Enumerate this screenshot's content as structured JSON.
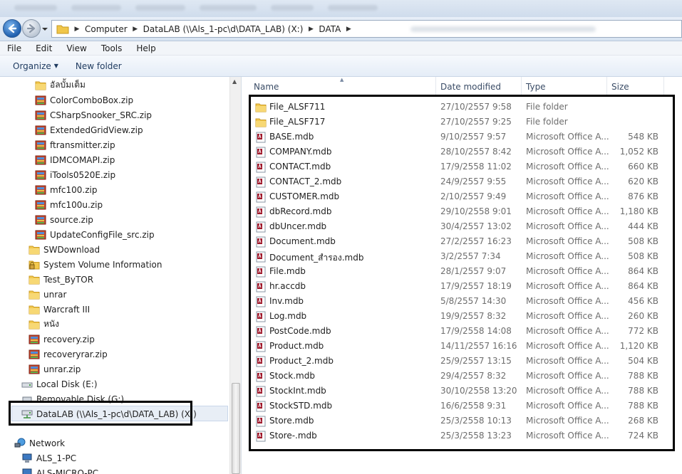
{
  "address": {
    "crumbs": [
      "Computer",
      "DataLAB (\\\\Als_1-pc\\d\\DATA_LAB) (X:)",
      "DATA"
    ]
  },
  "menu": [
    "File",
    "Edit",
    "View",
    "Tools",
    "Help"
  ],
  "toolbar": {
    "organize": "Organize",
    "new_folder": "New folder"
  },
  "nav": {
    "items": [
      {
        "label": "อัลบั้มเต็ม",
        "icon": "folder-icon"
      },
      {
        "label": "ColorComboBox.zip",
        "icon": "zip-archive-icon"
      },
      {
        "label": "CSharpSnooker_SRC.zip",
        "icon": "zip-archive-icon"
      },
      {
        "label": "ExtendedGridView.zip",
        "icon": "zip-archive-icon"
      },
      {
        "label": "ftransmitter.zip",
        "icon": "zip-archive-icon"
      },
      {
        "label": "IDMCOMAPI.zip",
        "icon": "zip-archive-icon"
      },
      {
        "label": "iTools0520E.zip",
        "icon": "zip-archive-icon"
      },
      {
        "label": "mfc100.zip",
        "icon": "zip-archive-icon"
      },
      {
        "label": "mfc100u.zip",
        "icon": "zip-archive-icon"
      },
      {
        "label": "source.zip",
        "icon": "zip-archive-icon"
      },
      {
        "label": "UpdateConfigFile_src.zip",
        "icon": "zip-archive-icon"
      },
      {
        "label": "SWDownload",
        "icon": "folder-icon"
      },
      {
        "label": "System Volume Information",
        "icon": "locked-folder-icon"
      },
      {
        "label": "Test_ByTOR",
        "icon": "folder-icon"
      },
      {
        "label": "unrar",
        "icon": "folder-icon"
      },
      {
        "label": "Warcraft III",
        "icon": "folder-icon"
      },
      {
        "label": "หนัง",
        "icon": "folder-icon"
      },
      {
        "label": "recovery.zip",
        "icon": "zip-archive-icon"
      },
      {
        "label": "recoveryrar.zip",
        "icon": "zip-archive-icon"
      },
      {
        "label": "unrar.zip",
        "icon": "zip-archive-icon"
      },
      {
        "label": "Local Disk (E:)",
        "icon": "drive-icon"
      },
      {
        "label": "Removable Disk (G:)",
        "icon": "removable-drive-icon"
      },
      {
        "label": "DataLAB (\\\\Als_1-pc\\d\\DATA_LAB) (X:)",
        "icon": "network-drive-icon"
      },
      {
        "label": "Network",
        "icon": "network-icon"
      },
      {
        "label": "ALS_1-PC",
        "icon": "computer-icon"
      },
      {
        "label": "ALS-MICRO-PC",
        "icon": "computer-icon"
      }
    ]
  },
  "columns": {
    "name": "Name",
    "date": "Date modified",
    "type": "Type",
    "size": "Size"
  },
  "files": [
    {
      "name": "File_ALSF711",
      "date": "27/10/2557 9:58",
      "type": "File folder",
      "size": "",
      "icon": "folder-icon"
    },
    {
      "name": "File_ALSF717",
      "date": "27/10/2557 9:25",
      "type": "File folder",
      "size": "",
      "icon": "folder-icon"
    },
    {
      "name": "BASE.mdb",
      "date": "9/10/2557 9:57",
      "type": "Microsoft Office A...",
      "size": "548 KB",
      "icon": "access-db-icon"
    },
    {
      "name": "COMPANY.mdb",
      "date": "28/10/2557 8:42",
      "type": "Microsoft Office A...",
      "size": "1,052 KB",
      "icon": "access-db-icon"
    },
    {
      "name": "CONTACT.mdb",
      "date": "17/9/2558 11:02",
      "type": "Microsoft Office A...",
      "size": "660 KB",
      "icon": "access-db-icon"
    },
    {
      "name": "CONTACT_2.mdb",
      "date": "24/9/2557 9:55",
      "type": "Microsoft Office A...",
      "size": "620 KB",
      "icon": "access-db-icon"
    },
    {
      "name": "CUSTOMER.mdb",
      "date": "2/10/2557 9:49",
      "type": "Microsoft Office A...",
      "size": "876 KB",
      "icon": "access-db-icon"
    },
    {
      "name": "dbRecord.mdb",
      "date": "29/10/2558 9:01",
      "type": "Microsoft Office A...",
      "size": "1,180 KB",
      "icon": "access-db-icon"
    },
    {
      "name": "dbUncer.mdb",
      "date": "30/4/2557 13:02",
      "type": "Microsoft Office A...",
      "size": "444 KB",
      "icon": "access-db-icon"
    },
    {
      "name": "Document.mdb",
      "date": "27/2/2557 16:23",
      "type": "Microsoft Office A...",
      "size": "508 KB",
      "icon": "access-db-icon"
    },
    {
      "name": "Document_สำรอง.mdb",
      "date": "3/2/2557 7:34",
      "type": "Microsoft Office A...",
      "size": "508 KB",
      "icon": "access-db-icon"
    },
    {
      "name": "File.mdb",
      "date": "28/1/2557 9:07",
      "type": "Microsoft Office A...",
      "size": "864 KB",
      "icon": "access-db-icon"
    },
    {
      "name": "hr.accdb",
      "date": "17/9/2557 18:19",
      "type": "Microsoft Office A...",
      "size": "864 KB",
      "icon": "access-db-icon"
    },
    {
      "name": "Inv.mdb",
      "date": "5/8/2557 14:30",
      "type": "Microsoft Office A...",
      "size": "456 KB",
      "icon": "access-db-icon"
    },
    {
      "name": "Log.mdb",
      "date": "19/9/2557 8:32",
      "type": "Microsoft Office A...",
      "size": "260 KB",
      "icon": "access-db-icon"
    },
    {
      "name": "PostCode.mdb",
      "date": "17/9/2558 14:08",
      "type": "Microsoft Office A...",
      "size": "772 KB",
      "icon": "access-db-icon"
    },
    {
      "name": "Product.mdb",
      "date": "14/11/2557 16:16",
      "type": "Microsoft Office A...",
      "size": "1,120 KB",
      "icon": "access-db-icon"
    },
    {
      "name": "Product_2.mdb",
      "date": "25/9/2557 13:15",
      "type": "Microsoft Office A...",
      "size": "504 KB",
      "icon": "access-db-icon"
    },
    {
      "name": "Stock.mdb",
      "date": "29/4/2557 8:32",
      "type": "Microsoft Office A...",
      "size": "788 KB",
      "icon": "access-db-icon"
    },
    {
      "name": "StockInt.mdb",
      "date": "30/10/2558 13:20",
      "type": "Microsoft Office A...",
      "size": "788 KB",
      "icon": "access-db-icon"
    },
    {
      "name": "StockSTD.mdb",
      "date": "16/6/2558 9:31",
      "type": "Microsoft Office A...",
      "size": "788 KB",
      "icon": "access-db-icon"
    },
    {
      "name": "Store.mdb",
      "date": "25/3/2558 10:13",
      "type": "Microsoft Office A...",
      "size": "268 KB",
      "icon": "access-db-icon"
    },
    {
      "name": "Store-.mdb",
      "date": "25/3/2558 13:23",
      "type": "Microsoft Office A...",
      "size": "724 KB",
      "icon": "access-db-icon"
    }
  ]
}
